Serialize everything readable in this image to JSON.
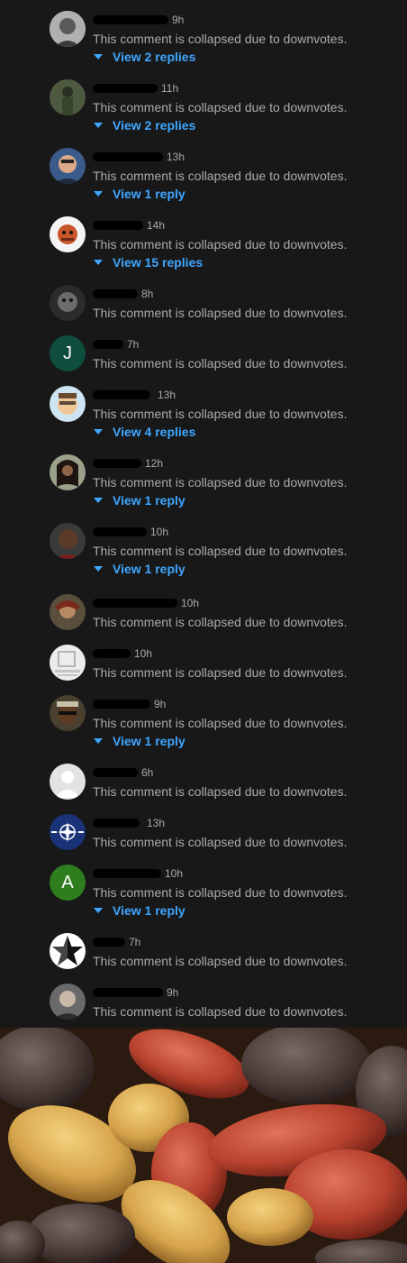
{
  "collapsed_text": "This comment is collapsed due to downvotes.",
  "comments": [
    {
      "time": "9h",
      "replies": "View 2 replies"
    },
    {
      "time": "11h",
      "replies": "View 2 replies"
    },
    {
      "time": "13h",
      "replies": "View 1 reply"
    },
    {
      "time": "14h",
      "replies": "View 15 replies"
    },
    {
      "time": "8h",
      "replies": ""
    },
    {
      "time": "7h",
      "replies": "",
      "avatar_letter": "J"
    },
    {
      "time": "13h",
      "replies": "View 4 replies"
    },
    {
      "time": "12h",
      "replies": "View 1 reply"
    },
    {
      "time": "10h",
      "replies": "View 1 reply"
    },
    {
      "time": "10h",
      "replies": ""
    },
    {
      "time": "10h",
      "replies": ""
    },
    {
      "time": "9h",
      "replies": "View 1 reply"
    },
    {
      "time": "6h",
      "replies": ""
    },
    {
      "time": "13h",
      "replies": ""
    },
    {
      "time": "10h",
      "replies": "View 1 reply",
      "avatar_letter": "A"
    },
    {
      "time": "7h",
      "replies": ""
    },
    {
      "time": "9h",
      "replies": ""
    }
  ],
  "colors": {
    "background": "#181818",
    "text_secondary": "#aaaaaa",
    "link": "#3ea6ff",
    "avatar_j": "#0f4d3c",
    "avatar_a": "#2e7d1e"
  },
  "icons": [
    "chevron-down-icon",
    "default-avatar-icon",
    "star-icon",
    "nato-emblem-icon"
  ]
}
